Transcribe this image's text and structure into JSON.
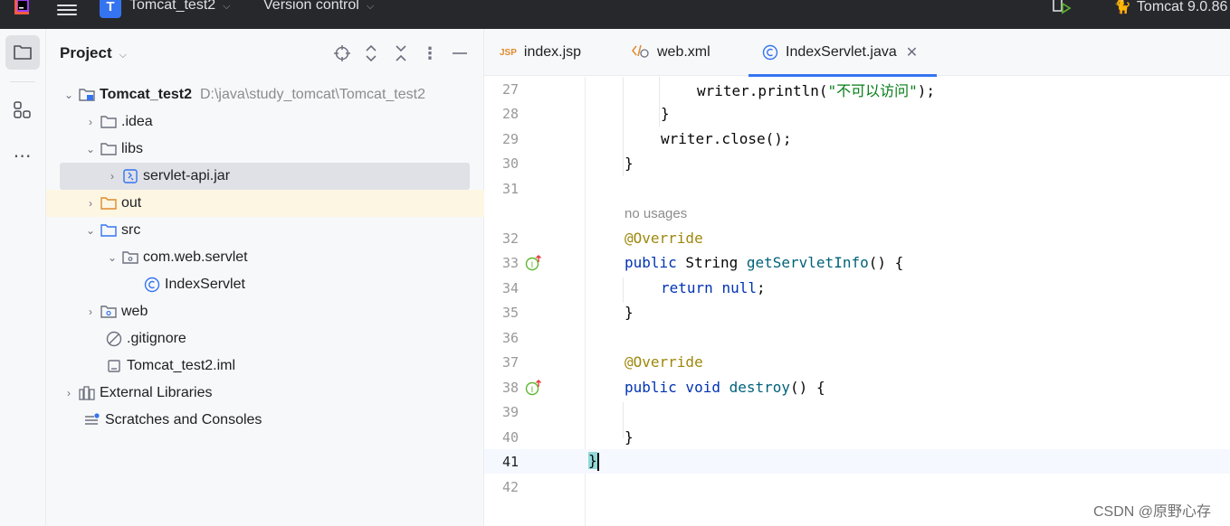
{
  "titlebar": {
    "project_badge": "T",
    "project_name": "Tomcat_test2",
    "version_control": "Version control",
    "run_config": "Tomcat 9.0.86"
  },
  "project_panel": {
    "title": "Project",
    "tree": [
      {
        "label": "Tomcat_test2",
        "path": "D:\\java\\study_tomcat\\Tomcat_test2",
        "icon": "module-folder-icon",
        "expanded": true,
        "depth": 0
      },
      {
        "label": ".idea",
        "icon": "folder-icon",
        "expanded": false,
        "depth": 1
      },
      {
        "label": "libs",
        "icon": "folder-icon",
        "expanded": true,
        "depth": 1
      },
      {
        "label": "servlet-api.jar",
        "icon": "jar-icon",
        "expanded": false,
        "depth": 2,
        "selected": true
      },
      {
        "label": "out",
        "icon": "excluded-folder-icon",
        "expanded": false,
        "depth": 1,
        "highlight": true
      },
      {
        "label": "src",
        "icon": "source-folder-icon",
        "expanded": true,
        "depth": 1
      },
      {
        "label": "com.web.servlet",
        "icon": "package-icon",
        "expanded": true,
        "depth": 2
      },
      {
        "label": "IndexServlet",
        "icon": "class-icon",
        "depth": 3
      },
      {
        "label": "web",
        "icon": "web-folder-icon",
        "expanded": false,
        "depth": 1
      },
      {
        "label": ".gitignore",
        "icon": "ignore-file-icon",
        "depth": 1
      },
      {
        "label": "Tomcat_test2.iml",
        "icon": "iml-file-icon",
        "depth": 1
      },
      {
        "label": "External Libraries",
        "icon": "libraries-icon",
        "expanded": false,
        "depth": 0
      },
      {
        "label": "Scratches and Consoles",
        "icon": "scratches-icon",
        "depth": 0
      }
    ]
  },
  "tabs": [
    {
      "label": "index.jsp",
      "icon": "jsp-icon"
    },
    {
      "label": "web.xml",
      "icon": "xml-icon"
    },
    {
      "label": "IndexServlet.java",
      "icon": "class-icon",
      "active": true
    }
  ],
  "editor": {
    "no_usages_hint": "no usages",
    "current_line": "41",
    "lines": [
      {
        "n": "27"
      },
      {
        "n": "28"
      },
      {
        "n": "29"
      },
      {
        "n": "30"
      },
      {
        "n": "31"
      },
      {
        "n": "32"
      },
      {
        "n": "33"
      },
      {
        "n": "34"
      },
      {
        "n": "35"
      },
      {
        "n": "36"
      },
      {
        "n": "37"
      },
      {
        "n": "38"
      },
      {
        "n": "39"
      },
      {
        "n": "40"
      },
      {
        "n": "41"
      },
      {
        "n": "42"
      }
    ],
    "code": {
      "l27_a": "writer.println(",
      "l27_str": "\"不可以访问\"",
      "l27_b": ");",
      "l28": "}",
      "l29": "writer.close();",
      "l30": "}",
      "l32": "@Override",
      "l33_kw": "public",
      "l33_type": " String ",
      "l33_fn": "getServletInfo",
      "l33_rest": "() {",
      "l34_kw": "return",
      "l34_null": "null",
      "l34_rest": ";",
      "l35": "}",
      "l37": "@Override",
      "l38_kw": "public void",
      "l38_fn": "destroy",
      "l38_rest": "() {",
      "l40": "}",
      "l41": "}"
    }
  },
  "watermark": "CSDN @原野心存",
  "colors": {
    "titlebar_bg": "#27282c",
    "accent": "#3574f0",
    "keyword": "#0033b3",
    "function": "#00627a",
    "string": "#067d17",
    "annotation": "#9e880d"
  }
}
